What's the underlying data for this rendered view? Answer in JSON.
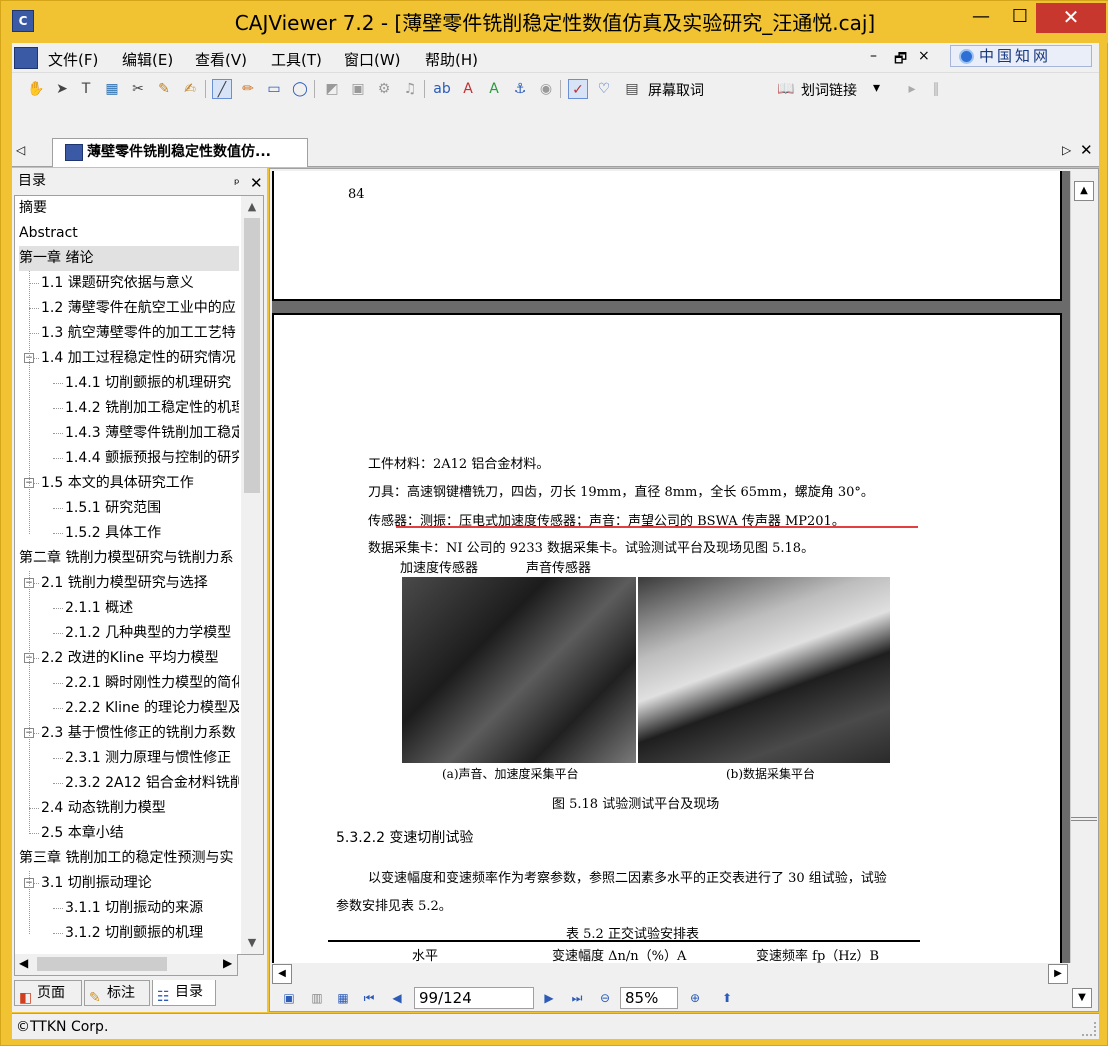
{
  "window": {
    "title": "CAJViewer 7.2 - [薄壁零件铣削稳定性数值仿真及实验研究_汪通悦.caj]",
    "min": "—",
    "max": "☐",
    "close": "✕"
  },
  "menu": {
    "items": [
      "文件(F)",
      "编辑(E)",
      "查看(V)",
      "工具(T)",
      "窗口(W)",
      "帮助(H)"
    ],
    "mdi_min": "–",
    "mdi_restore": "🗗",
    "mdi_close": "×",
    "cnki": "中国知网"
  },
  "toolbar": {
    "screen_lookup": "屏幕取词",
    "word_link": "划词链接",
    "dropdown": "▾"
  },
  "tab": {
    "label": "薄壁零件铣削稳定性数值仿...",
    "scroll_left": "◁",
    "scroll_right": "▷",
    "close": "✕"
  },
  "sidebar": {
    "title": "目录",
    "pin": "ᅟ🖈",
    "close": "✕",
    "items": [
      {
        "label": "摘要",
        "level": 0
      },
      {
        "label": "Abstract",
        "level": 0
      },
      {
        "label": "第一章 绪论",
        "level": 0,
        "selected": true
      },
      {
        "label": "1.1 课题研究依据与意义",
        "level": 1
      },
      {
        "label": "1.2 薄壁零件在航空工业中的应",
        "level": 1
      },
      {
        "label": "1.3 航空薄壁零件的加工工艺特",
        "level": 1
      },
      {
        "label": "1.4 加工过程稳定性的研究情况",
        "level": 1,
        "expanded": true
      },
      {
        "label": "1.4.1 切削颤振的机理研究",
        "level": 2
      },
      {
        "label": "1.4.2 铣削加工稳定性的机理",
        "level": 2
      },
      {
        "label": "1.4.3 薄壁零件铣削加工稳定",
        "level": 2
      },
      {
        "label": "1.4.4 颤振预报与控制的研究",
        "level": 2
      },
      {
        "label": "1.5 本文的具体研究工作",
        "level": 1,
        "expanded": true
      },
      {
        "label": "1.5.1 研究范围",
        "level": 2
      },
      {
        "label": "1.5.2 具体工作",
        "level": 2
      },
      {
        "label": "第二章 铣削力模型研究与铣削力系",
        "level": 0
      },
      {
        "label": "2.1 铣削力模型研究与选择",
        "level": 1,
        "expanded": true
      },
      {
        "label": "2.1.1 概述",
        "level": 2
      },
      {
        "label": "2.1.2 几种典型的力学模型",
        "level": 2
      },
      {
        "label": "2.2 改进的Kline 平均力模型",
        "level": 1,
        "expanded": true
      },
      {
        "label": "2.2.1 瞬时刚性力模型的简化",
        "level": 2
      },
      {
        "label": "2.2.2 Kline 的理论力模型及",
        "level": 2
      },
      {
        "label": "2.3 基于惯性修正的铣削力系数",
        "level": 1,
        "expanded": true
      },
      {
        "label": "2.3.1 测力原理与惯性修正",
        "level": 2
      },
      {
        "label": "2.3.2 2A12 铝合金材料铣削",
        "level": 2
      },
      {
        "label": "2.4 动态铣削力模型",
        "level": 1
      },
      {
        "label": "2.5 本章小结",
        "level": 1
      },
      {
        "label": "第三章 铣削加工的稳定性预测与实",
        "level": 0
      },
      {
        "label": "3.1 切削振动理论",
        "level": 1,
        "expanded": true
      },
      {
        "label": "3.1.1 切削振动的来源",
        "level": 2
      },
      {
        "label": "3.1.2 切削颤振的机理",
        "level": 2
      }
    ],
    "tabs": [
      "页面",
      "标注",
      "目录"
    ]
  },
  "document": {
    "page1_number": "84",
    "lines": {
      "material": "工件材料：2A12 铝合金材料。",
      "tool": "刀具：高速钢键槽铣刀，四齿，刃长 19mm，直径 8mm，全长 65mm，螺旋角 30°。",
      "sensor": "传感器：测振：压电式加速度传感器；声音：声望公司的 BSWA 传声器 MP201。",
      "daq": "数据采集卡：NI 公司的 9233 数据采集卡。试验测试平台及现场见图 5.18。",
      "label_accel": "加速度传感器",
      "label_sound": "声音传感器",
      "cap_a": "(a)声音、加速度采集平台",
      "cap_b": "(b)数据采集平台",
      "fig_caption": "图 5.18  试验测试平台及现场",
      "section": "5.3.2.2 变速切削试验",
      "para1": "以变速幅度和变速频率作为考察参数，参照二因素多水平的正交表进行了 30 组试验，试验",
      "para2": "参数安排见表 5.2。",
      "table_title": "表 5.2   正交试验安排表",
      "col1": "水平",
      "col2": "变速幅度 Δn/n（%）A",
      "col3": "变速频率 fp（Hz）B"
    }
  },
  "navigator": {
    "page": "99/124",
    "zoom": "85%"
  },
  "status": {
    "text": "©TTKN Corp."
  }
}
